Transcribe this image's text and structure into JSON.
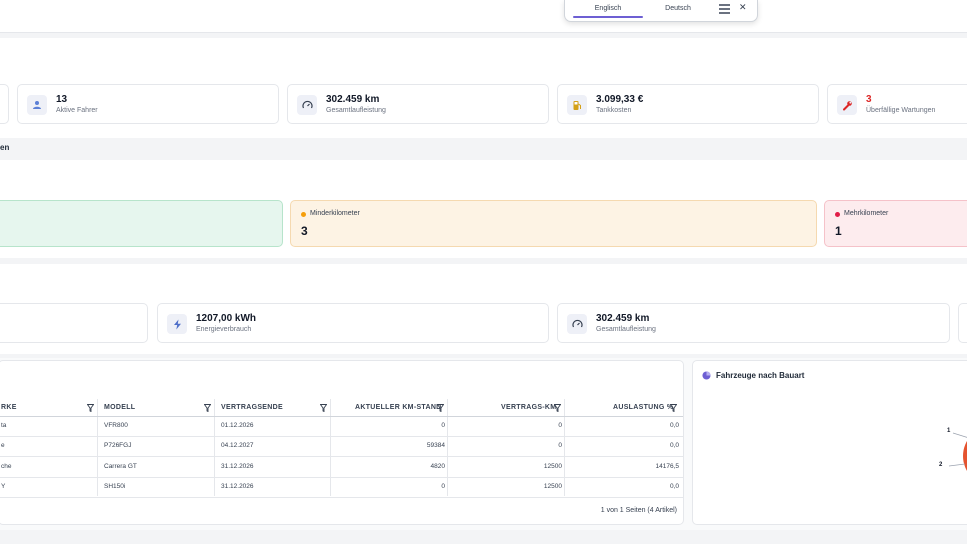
{
  "language": {
    "tabs": [
      "Englisch",
      "Deutsch"
    ],
    "active": "Englisch"
  },
  "summary_cards": [
    {
      "value": "13",
      "label": "Aktive Fahrer",
      "icon": "user-icon"
    },
    {
      "value": "302.459 km",
      "label": "Gesamtlaufleistung",
      "icon": "speedometer-icon"
    },
    {
      "value": "3.099,33 €",
      "label": "Tankkosten",
      "icon": "fuel-icon"
    },
    {
      "value": "3",
      "label": "Überfällige Wartungen",
      "icon": "wrench-icon",
      "value_color": "#dc2626"
    }
  ],
  "section_label": "en",
  "km_cards": [
    {
      "title": "Minderkilometer",
      "value": "3",
      "dot_color": "#f59e0b",
      "bg": "#fdf3e4",
      "border": "#f5d9b0"
    },
    {
      "title": "Mehrkilometer",
      "value": "1",
      "dot_color": "#e11d48",
      "bg": "#fdecee",
      "border": "#f5c2c9"
    }
  ],
  "green_card": {
    "bg": "#e6f6ee",
    "border": "#b7e4cb"
  },
  "energy_cards": [
    {
      "value": "1207,00 kWh",
      "label": "Energieverbrauch",
      "icon": "bolt-icon"
    },
    {
      "value": "302.459 km",
      "label": "Gesamtlaufleistung",
      "icon": "speedometer-icon"
    }
  ],
  "table": {
    "headers": [
      "RKE",
      "MODELL",
      "VERTRAGSENDE",
      "AKTUELLER KM-STAND",
      "VERTRAGS-KM",
      "AUSLASTUNG %"
    ],
    "rows": [
      [
        "ta",
        "VFR800",
        "01.12.2026",
        "0",
        "0",
        "0,0"
      ],
      [
        "e",
        "P726FGJ",
        "04.12.2027",
        "59384",
        "0",
        "0,0"
      ],
      [
        "che",
        "Carrera GT",
        "31.12.2026",
        "4820",
        "12500",
        "14176,5"
      ],
      [
        "Y",
        "SH150i",
        "31.12.2026",
        "0",
        "12500",
        "0,0"
      ]
    ],
    "pager": "1 von 1 Seiten (4 Artikel)"
  },
  "chart": {
    "title": "Fahrzeuge nach Bauart",
    "labels": [
      "1",
      "2"
    ],
    "accent": "#e5532f"
  }
}
